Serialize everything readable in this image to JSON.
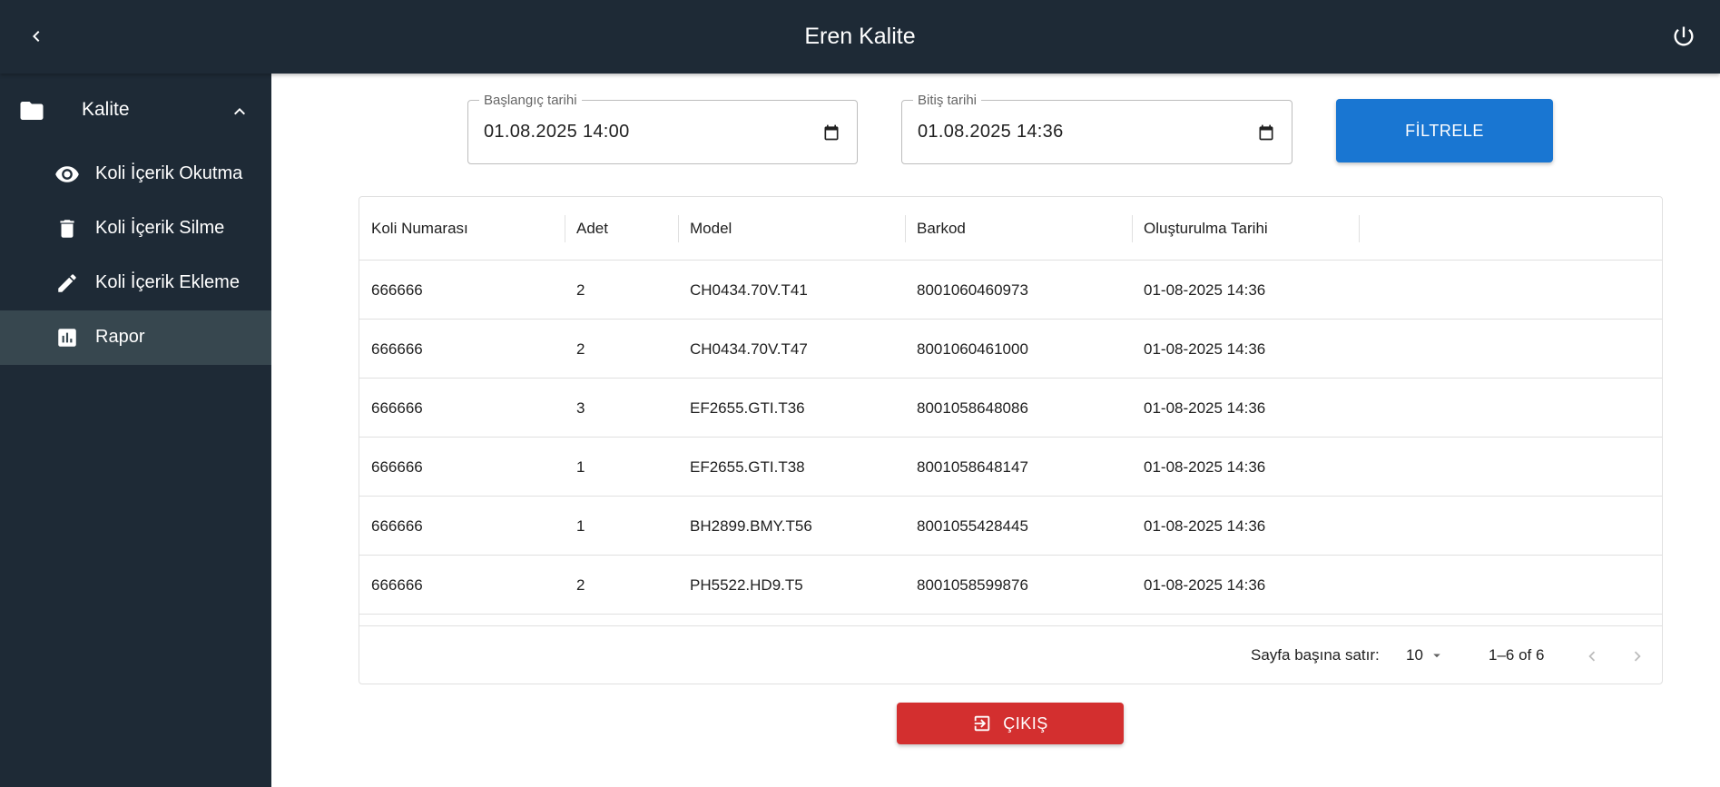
{
  "appbar": {
    "title": "Eren Kalite",
    "back_icon": "chevron-left-icon",
    "power_icon": "power-icon"
  },
  "sidebar": {
    "group": {
      "label": "Kalite",
      "icon": "folder-icon",
      "expanded": true
    },
    "items": [
      {
        "label": "Koli İçerik Okutma",
        "icon": "eye-icon",
        "active": false
      },
      {
        "label": "Koli İçerik Silme",
        "icon": "trash-icon",
        "active": false
      },
      {
        "label": "Koli İçerik Ekleme",
        "icon": "pencil-icon",
        "active": false
      },
      {
        "label": "Rapor",
        "icon": "bar-chart-icon",
        "active": true
      }
    ]
  },
  "filters": {
    "start": {
      "label": "Başlangıç tarihi",
      "value": "01.08.2025 14:00"
    },
    "end": {
      "label": "Bitiş tarihi",
      "value": "01.08.2025 14:36"
    },
    "button_label": "FİLTRELE"
  },
  "table": {
    "columns": [
      "Koli Numarası",
      "Adet",
      "Model",
      "Barkod",
      "Oluşturulma Tarihi"
    ],
    "rows": [
      [
        "666666",
        "2",
        "CH0434.70V.T41",
        "8001060460973",
        "01-08-2025 14:36"
      ],
      [
        "666666",
        "2",
        "CH0434.70V.T47",
        "8001060461000",
        "01-08-2025 14:36"
      ],
      [
        "666666",
        "3",
        "EF2655.GTI.T36",
        "8001058648086",
        "01-08-2025 14:36"
      ],
      [
        "666666",
        "1",
        "EF2655.GTI.T38",
        "8001058648147",
        "01-08-2025 14:36"
      ],
      [
        "666666",
        "1",
        "BH2899.BMY.T56",
        "8001055428445",
        "01-08-2025 14:36"
      ],
      [
        "666666",
        "2",
        "PH5522.HD9.T5",
        "8001058599876",
        "01-08-2025 14:36"
      ]
    ],
    "pagination": {
      "rows_per_page_label": "Sayfa başına satır:",
      "rows_per_page": "10",
      "range": "1–6 of 6"
    }
  },
  "exit_button": {
    "label": "ÇIKIŞ",
    "icon": "exit-icon"
  },
  "colors": {
    "appbar": "#1e2a36",
    "sidebar_active": "#37474f",
    "primary": "#1976d2",
    "danger": "#d32f2f"
  }
}
